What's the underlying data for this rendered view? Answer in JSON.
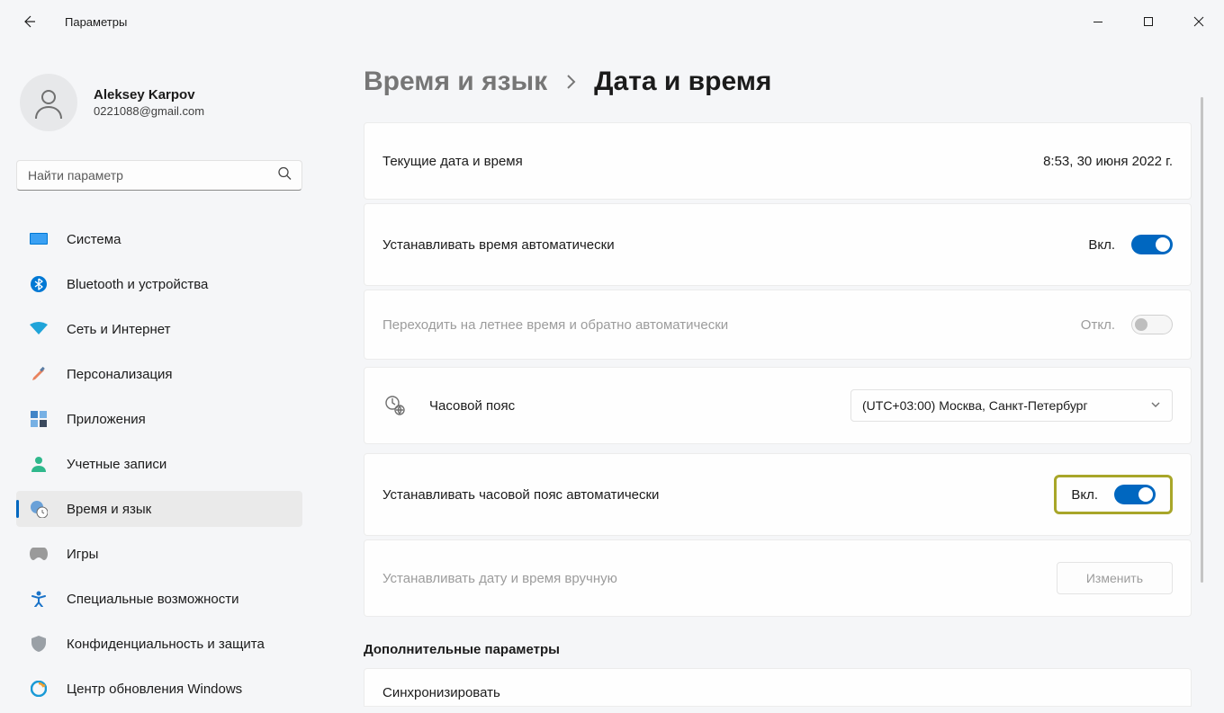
{
  "app": {
    "title": "Параметры"
  },
  "profile": {
    "name": "Aleksey Karpov",
    "email": "0221088@gmail.com"
  },
  "search": {
    "placeholder": "Найти параметр"
  },
  "sidebar": {
    "items": [
      {
        "label": "Система"
      },
      {
        "label": "Bluetooth и устройства"
      },
      {
        "label": "Сеть и Интернет"
      },
      {
        "label": "Персонализация"
      },
      {
        "label": "Приложения"
      },
      {
        "label": "Учетные записи"
      },
      {
        "label": "Время и язык"
      },
      {
        "label": "Игры"
      },
      {
        "label": "Специальные возможности"
      },
      {
        "label": "Конфиденциальность и защита"
      },
      {
        "label": "Центр обновления Windows"
      }
    ]
  },
  "breadcrumb": {
    "parent": "Время и язык",
    "current": "Дата и время"
  },
  "rows": {
    "current": {
      "label": "Текущие дата и время",
      "value": "8:53, 30 июня 2022 г."
    },
    "autoTime": {
      "label": "Устанавливать время автоматически",
      "state": "Вкл."
    },
    "dst": {
      "label": "Переходить на летнее время и обратно автоматически",
      "state": "Откл."
    },
    "timezone": {
      "label": "Часовой пояс",
      "value": "(UTC+03:00) Москва, Санкт-Петербург"
    },
    "autoTz": {
      "label": "Устанавливать часовой пояс автоматически",
      "state": "Вкл."
    },
    "manual": {
      "label": "Устанавливать дату и время вручную",
      "button": "Изменить"
    }
  },
  "section": {
    "additional": "Дополнительные параметры",
    "sync": "Синхронизировать"
  }
}
